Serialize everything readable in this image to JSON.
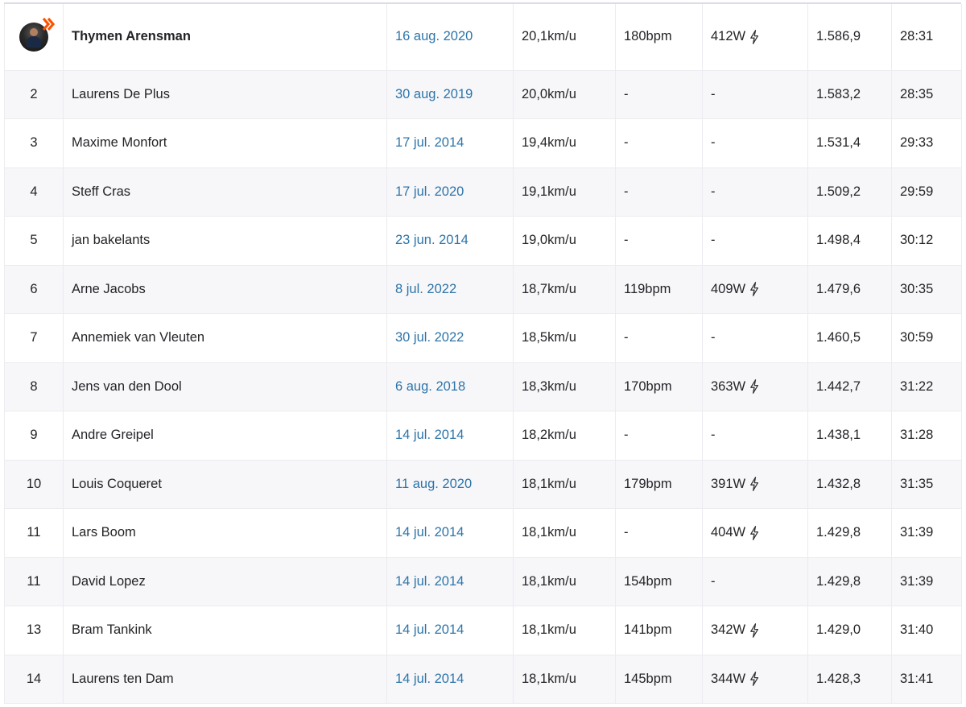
{
  "columns": [
    "rank",
    "name",
    "date",
    "speed",
    "heart_rate",
    "power",
    "vam",
    "time"
  ],
  "rows": [
    {
      "rank": "",
      "avatar": "user-avatar",
      "name": "Thymen Arensman",
      "date": "16 aug. 2020",
      "speed": "20,1km/u",
      "heart_rate": "180bpm",
      "power": "412W",
      "power_icon": "lightning-icon",
      "vam": "1.586,9",
      "time": "28:31"
    },
    {
      "rank": "2",
      "name": "Laurens De Plus",
      "date": "30 aug. 2019",
      "speed": "20,0km/u",
      "heart_rate": "-",
      "power": "-",
      "vam": "1.583,2",
      "time": "28:35"
    },
    {
      "rank": "3",
      "name": "Maxime Monfort",
      "date": "17 jul. 2014",
      "speed": "19,4km/u",
      "heart_rate": "-",
      "power": "-",
      "vam": "1.531,4",
      "time": "29:33"
    },
    {
      "rank": "4",
      "name": "Steff Cras",
      "date": "17 jul. 2020",
      "speed": "19,1km/u",
      "heart_rate": "-",
      "power": "-",
      "vam": "1.509,2",
      "time": "29:59"
    },
    {
      "rank": "5",
      "name": "jan bakelants",
      "date": "23 jun. 2014",
      "speed": "19,0km/u",
      "heart_rate": "-",
      "power": "-",
      "vam": "1.498,4",
      "time": "30:12"
    },
    {
      "rank": "6",
      "name": "Arne Jacobs",
      "date": "8 jul. 2022",
      "speed": "18,7km/u",
      "heart_rate": "119bpm",
      "power": "409W",
      "power_icon": "lightning-icon",
      "vam": "1.479,6",
      "time": "30:35"
    },
    {
      "rank": "7",
      "name": "Annemiek van Vleuten",
      "date": "30 jul. 2022",
      "speed": "18,5km/u",
      "heart_rate": "-",
      "power": "-",
      "vam": "1.460,5",
      "time": "30:59"
    },
    {
      "rank": "8",
      "name": "Jens van den Dool",
      "date": "6 aug. 2018",
      "speed": "18,3km/u",
      "heart_rate": "170bpm",
      "power": "363W",
      "power_icon": "lightning-icon",
      "vam": "1.442,7",
      "time": "31:22"
    },
    {
      "rank": "9",
      "name": "Andre Greipel",
      "date": "14 jul. 2014",
      "speed": "18,2km/u",
      "heart_rate": "-",
      "power": "-",
      "vam": "1.438,1",
      "time": "31:28"
    },
    {
      "rank": "10",
      "name": "Louis Coqueret",
      "date": "11 aug. 2020",
      "speed": "18,1km/u",
      "heart_rate": "179bpm",
      "power": "391W",
      "power_icon": "lightning-icon",
      "vam": "1.432,8",
      "time": "31:35"
    },
    {
      "rank": "11",
      "name": "Lars Boom",
      "date": "14 jul. 2014",
      "speed": "18,1km/u",
      "heart_rate": "-",
      "power": "404W",
      "power_icon": "lightning-icon",
      "vam": "1.429,8",
      "time": "31:39"
    },
    {
      "rank": "11",
      "name": "David Lopez",
      "date": "14 jul. 2014",
      "speed": "18,1km/u",
      "heart_rate": "154bpm",
      "power": "-",
      "vam": "1.429,8",
      "time": "31:39"
    },
    {
      "rank": "13",
      "name": "Bram Tankink",
      "date": "14 jul. 2014",
      "speed": "18,1km/u",
      "heart_rate": "141bpm",
      "power": "342W",
      "power_icon": "lightning-icon",
      "vam": "1.429,0",
      "time": "31:40"
    },
    {
      "rank": "14",
      "name": "Laurens ten Dam",
      "date": "14 jul. 2014",
      "speed": "18,1km/u",
      "heart_rate": "145bpm",
      "power": "344W",
      "power_icon": "lightning-icon",
      "vam": "1.428,3",
      "time": "31:41"
    }
  ],
  "colors": {
    "link": "#2d74a8",
    "row_alt": "#f7f7fa",
    "border": "#ececf0",
    "badge": "#fc5200"
  }
}
